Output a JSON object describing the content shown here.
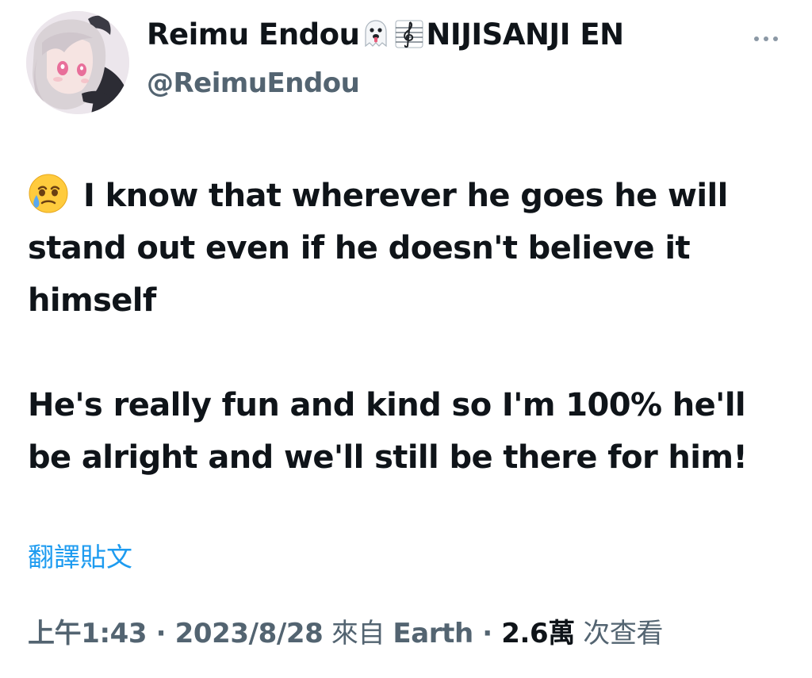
{
  "author": {
    "name_part1": "Reimu Endou",
    "emoji1_icon": "ghost-tongue-emoji",
    "emoji2_icon": "treble-clef-emoji",
    "name_part2": "NIJISANJI EN",
    "handle": "@ReimuEndou",
    "avatar_icon": "anime-girl-avatar"
  },
  "more_icon": "more-options-icon",
  "tweet": {
    "lead_emoji_icon": "face-holding-back-tears-emoji",
    "paragraph1": "I know that wherever he goes he will stand out even if he doesn't believe it himself",
    "paragraph2": "He's really fun and kind so I'm 100% he'll be alright and we'll still be there for him!"
  },
  "translate_label": "翻譯貼文",
  "meta": {
    "time": "上午1:43",
    "sep1": " · ",
    "date": "2023/8/28",
    "source_prefix": " 來自 ",
    "source": "Earth",
    "sep2": " · ",
    "views": "2.6萬",
    "views_label": " 次查看"
  },
  "colors": {
    "text": "#0f1419",
    "secondary": "#536471",
    "link": "#1d9bf0"
  }
}
